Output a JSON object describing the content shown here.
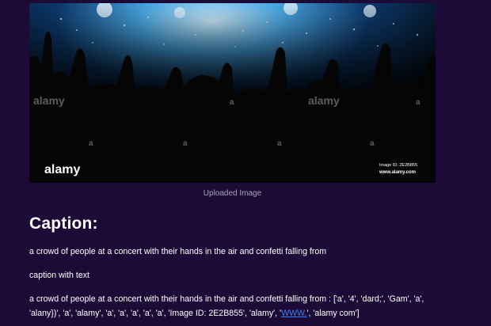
{
  "image": {
    "caption": "Uploaded Image",
    "watermark": "alamy",
    "watermark_small": "a",
    "logo": "alamy",
    "image_id_text": "Image ID: 2E2B855",
    "site_text": "www.alamy.com"
  },
  "caption_section": {
    "heading": "Caption:",
    "caption_text": "a crowd of people at a concert with their hands in the air and confetti falling from",
    "caption_with_text_label": "caption with text",
    "combined_prefix": "a crowd of people at a concert with their hands in the air and confetti falling from : ['a', '4', 'dard;', 'Gam', 'a', 'alany})', 'a', 'alamy', 'a', 'a', 'a', 'a', 'a', 'Image ID: 2E2B855', 'alamy', '",
    "combined_link": "WWW.",
    "combined_suffix": "', 'alamy com']"
  },
  "colors": {
    "background": "#1c0b36",
    "text": "#ffffff",
    "muted": "#a9a6b5",
    "link": "#3b82f6"
  }
}
